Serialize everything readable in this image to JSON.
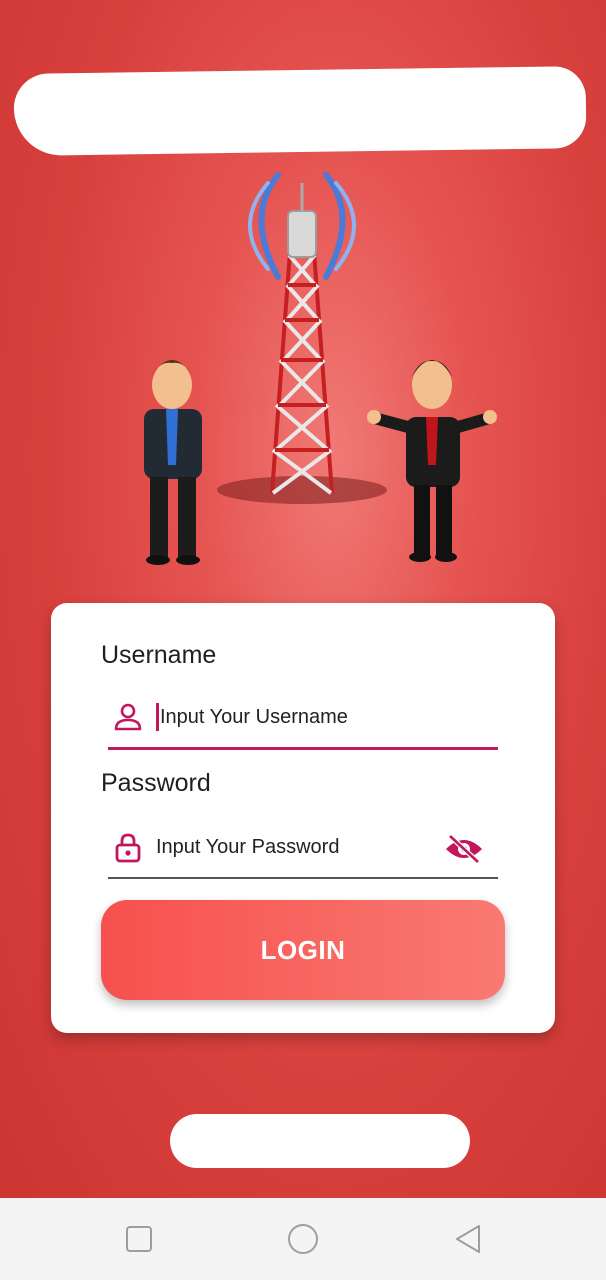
{
  "login_form": {
    "username_label": "Username",
    "username_placeholder": "Input Your Username",
    "password_label": "Password",
    "password_placeholder": "Input Your Password",
    "login_button": "LOGIN"
  },
  "colors": {
    "accent": "#c2185b",
    "background_red": "#d8403d",
    "button_gradient_start": "#f7504e",
    "button_gradient_end": "#f97a72"
  },
  "icons": {
    "username_icon": "person-icon",
    "password_icon": "lock-icon",
    "visibility_toggle": "eye-off-icon",
    "nav_recent": "square-icon",
    "nav_home": "circle-icon",
    "nav_back": "triangle-back-icon"
  }
}
